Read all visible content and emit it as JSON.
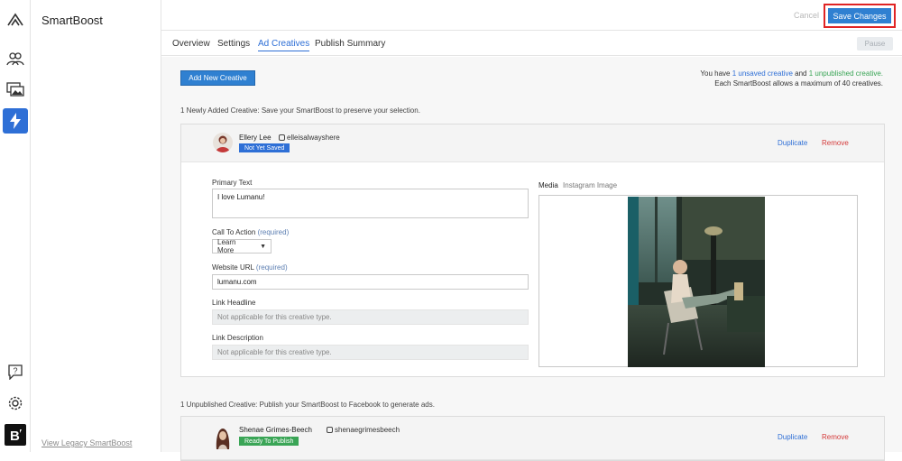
{
  "app": {
    "brand": "SmartBoost",
    "legacy_link": "View Legacy SmartBoost"
  },
  "toolbar": {
    "cancel_label": "Cancel",
    "save_label": "Save Changes",
    "pause_label": "Pause"
  },
  "tabs": [
    {
      "label": "Overview"
    },
    {
      "label": "Settings"
    },
    {
      "label": "Ad Creatives",
      "active": true
    },
    {
      "label": "Publish Summary"
    }
  ],
  "main": {
    "add_button": "Add New Creative",
    "notice": {
      "prefix": "You have",
      "unsaved": "1 unsaved creative",
      "and": "and",
      "unpublished": "1 unpublished creative.",
      "line2": "Each SmartBoost allows a maximum of 40 creatives."
    },
    "new_section": {
      "title": "1 Newly Added Creative:",
      "subtitle": "Save your SmartBoost to preserve your selection."
    },
    "unpublished_section": {
      "title": "1 Unpublished Creative:",
      "subtitle": "Publish your SmartBoost to Facebook to generate ads."
    }
  },
  "creative1": {
    "name": "Ellery Lee",
    "handle": "elleisalwayshere",
    "badge": "Not Yet Saved",
    "duplicate": "Duplicate",
    "remove": "Remove",
    "primary_text_label": "Primary Text",
    "primary_text_value": "I love Lumanu!",
    "cta_label": "Call To Action",
    "cta_required": "(required)",
    "cta_value": "Learn More",
    "url_label": "Website URL",
    "url_required": "(required)",
    "url_value": "lumanu.com",
    "headline_label": "Link Headline",
    "headline_value": "Not applicable for this creative type.",
    "description_label": "Link Description",
    "description_value": "Not applicable for this creative type.",
    "media_label": "Media",
    "media_type": "Instagram Image"
  },
  "creative2": {
    "name": "Shenae Grimes-Beech",
    "handle": "shenaegrimesbeech",
    "badge": "Ready To Publish",
    "duplicate": "Duplicate",
    "remove": "Remove"
  },
  "colors": {
    "accent": "#2f80d1",
    "highlight": "#e02424",
    "badge_unsaved": "#2e6fd6",
    "badge_ready": "#3aa556",
    "remove": "#d43a3a"
  },
  "icons": [
    "logo-icon",
    "people-icon",
    "images-icon",
    "lightning-icon",
    "help-icon",
    "gear-icon",
    "b-brand-icon",
    "instagram-icon",
    "caret-down-icon"
  ]
}
